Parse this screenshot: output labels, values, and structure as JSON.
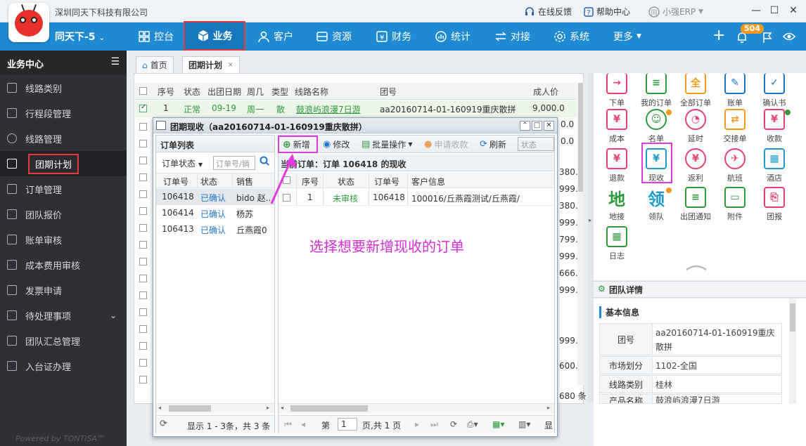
{
  "window": {
    "company": "深圳同天下科技有限公司",
    "links": {
      "feedback": "在线反馈",
      "help": "帮助中心",
      "product": "小强ERP"
    }
  },
  "nav": {
    "unit": "同天下-5",
    "items": [
      "控台",
      "业务",
      "客户",
      "资源",
      "财务",
      "统计",
      "对接",
      "系统",
      "更多"
    ],
    "badge": "504",
    "accent": "#1e8ad2"
  },
  "sidebar": {
    "title": "业务中心",
    "items": [
      "线路类别",
      "行程段管理",
      "线路管理",
      "团期计划",
      "订单管理",
      "团队报价",
      "账单审核",
      "成本费用审核",
      "发票申请",
      "待处理事项",
      "团队汇总管理",
      "入台证办理"
    ],
    "powered": "Powered by TONTISA™"
  },
  "tabs": {
    "home": "首页",
    "team": "团期计划"
  },
  "bg_grid": {
    "headers": [
      "序号",
      "状态",
      "出团日期",
      "周几",
      "类型",
      "线路名称",
      "团号",
      "成人价"
    ],
    "row1": {
      "seq": "1",
      "status": "正常",
      "date": "09-19",
      "weekday": "周一",
      "type": "散",
      "route": "鼓浪屿浪漫7日游",
      "group": "aa20160714-01-160919重庆散拼",
      "price": "9,000.0"
    },
    "prices": [
      "0.0",
      "0.0",
      "380.0",
      "999.0",
      "380.0",
      "999.0",
      "799.0",
      "999.0",
      "666.0",
      "999.0",
      "999.0",
      "600.0",
      "680 条"
    ]
  },
  "modal": {
    "title": "团期现收（aa20160714-01-160919重庆散拼）",
    "left": {
      "title": "订单列表",
      "filter": "订单状态",
      "search_placeholder": "订单号/销",
      "headers": [
        "订单号",
        "状态",
        "销售"
      ],
      "rows": [
        {
          "id": "106418",
          "status": "已确认",
          "sales": "bido 赵..."
        },
        {
          "id": "106414",
          "status": "已确认",
          "sales": "杨苏"
        },
        {
          "id": "106413",
          "status": "已确认",
          "sales": "丘燕霞0"
        }
      ],
      "summary": "显示 1 - 3条，共 3 条"
    },
    "right": {
      "toolbar": {
        "add": "新增",
        "edit": "修改",
        "batch": "批量操作",
        "apply": "申请收款",
        "refresh": "刷新",
        "state": "状态"
      },
      "current": "当前订单：订单 106418 的现收",
      "headers": [
        "序号",
        "状态",
        "订单号",
        "客户信息"
      ],
      "rows": [
        {
          "seq": "1",
          "status": "未审核",
          "order": "106418",
          "customer": "100016/丘燕霞测试/丘燕霞/"
        }
      ],
      "pager": {
        "page_label": "第",
        "page": "1",
        "total": "页,共 1 页",
        "show": "显"
      }
    }
  },
  "annotation": "选择想要新增现收的订单",
  "quick_actions": [
    "下单",
    "我的订单",
    "全部订单",
    "账单",
    "确认书",
    "成本",
    "名单",
    "延时",
    "交接单",
    "收款",
    "退款",
    "现收",
    "返利",
    "航班",
    "酒店",
    "地接",
    "领队",
    "出团通知",
    "附件",
    "团报",
    "日志"
  ],
  "team_details": {
    "title": "团队详情",
    "basic": "基本信息",
    "rows": [
      {
        "k": "团号",
        "v": "aa20160714-01-160919重庆散拼"
      },
      {
        "k": "市场划分",
        "v": "1102-全国"
      },
      {
        "k": "线路类别",
        "v": "桂林"
      },
      {
        "k": "产品名称",
        "v": "鼓浪屿浪漫7日游"
      }
    ]
  }
}
